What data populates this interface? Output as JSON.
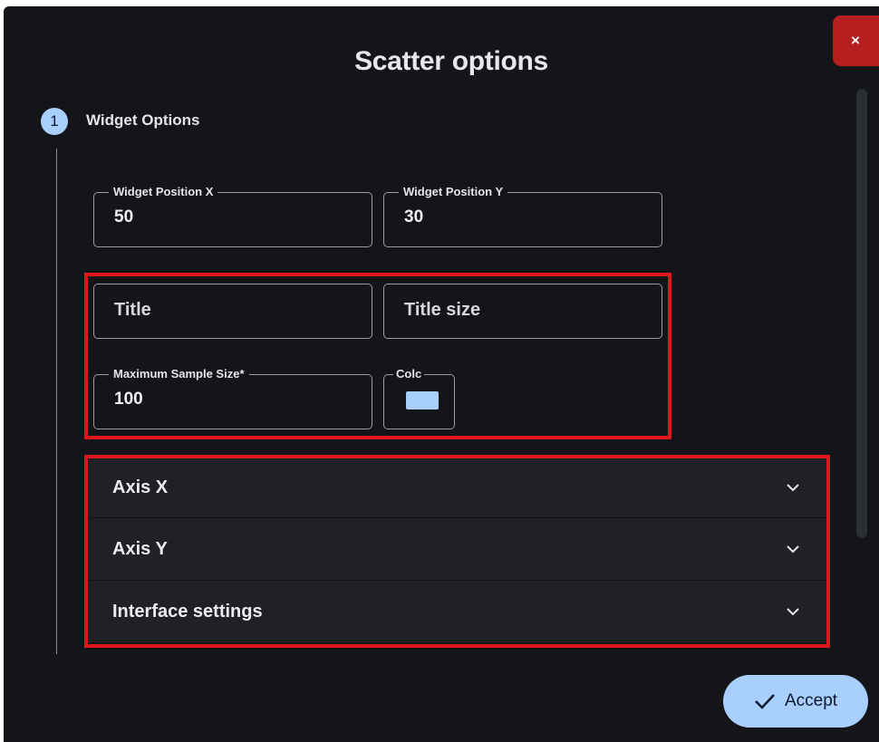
{
  "dialog": {
    "title": "Scatter options",
    "close_label": "×"
  },
  "step": {
    "number": "1",
    "label": "Widget Options"
  },
  "fields": {
    "position_x": {
      "label": "Widget Position X",
      "value": "50"
    },
    "position_y": {
      "label": "Widget Position Y",
      "value": "30"
    },
    "title": {
      "placeholder": "Title"
    },
    "title_size": {
      "placeholder": "Title size"
    },
    "max_sample": {
      "label": "Maximum Sample Size*",
      "value": "100"
    },
    "color": {
      "label": "Colc",
      "value": "#a9cfff"
    }
  },
  "accordion": {
    "items": [
      {
        "label": "Axis X"
      },
      {
        "label": "Axis Y"
      },
      {
        "label": "Interface settings"
      }
    ]
  },
  "actions": {
    "accept_label": "Accept"
  },
  "colors": {
    "background": "#131519",
    "accent": "#a9cfff",
    "close": "#b51f1f",
    "highlight": "#e0161e"
  },
  "icons": {
    "close": "close-icon",
    "chevron": "chevron-down-icon",
    "check": "check-icon"
  }
}
